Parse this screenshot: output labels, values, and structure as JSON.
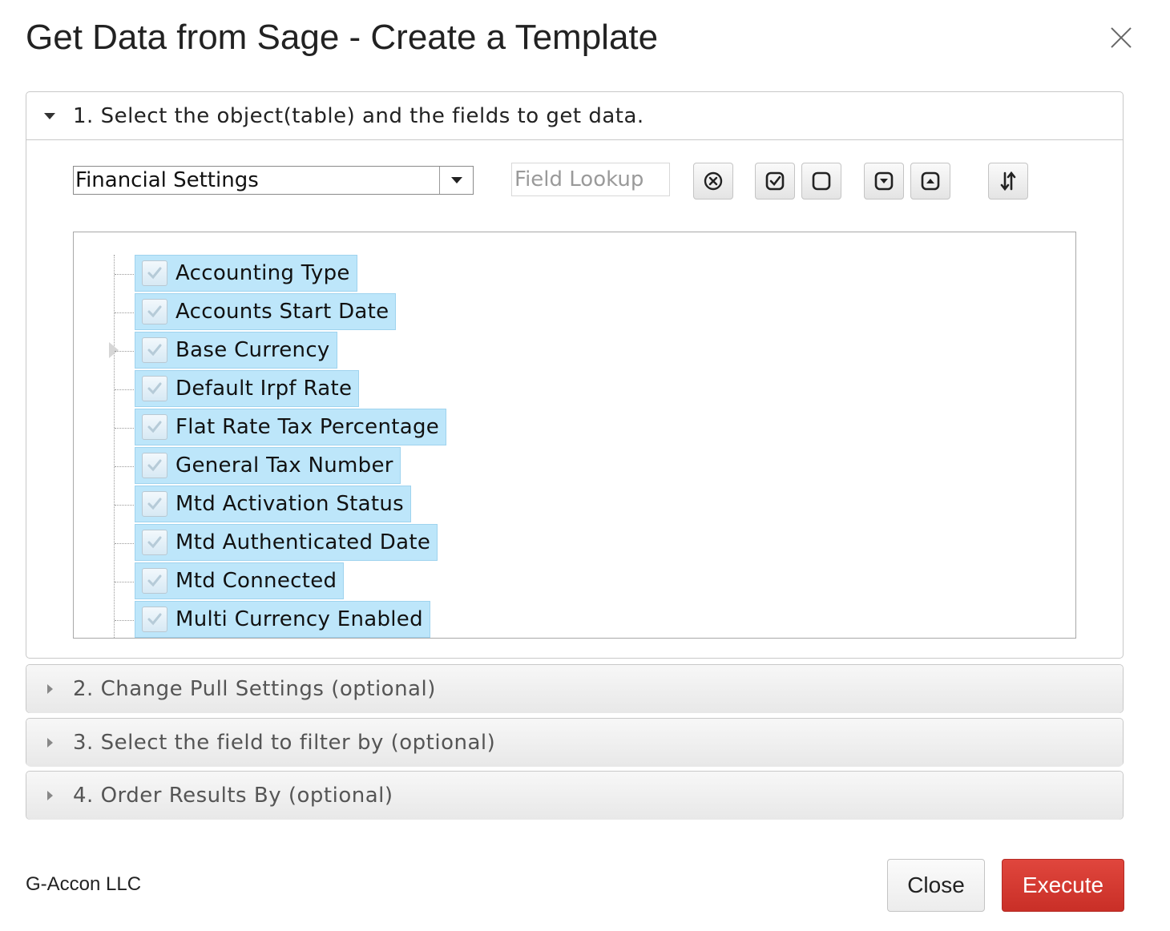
{
  "dialog": {
    "title": "Get Data from Sage - Create a Template",
    "close_icon": "close-icon"
  },
  "section1": {
    "title": "1. Select the object(table) and the fields to get data.",
    "object_select": {
      "value": "Financial Settings"
    },
    "field_lookup": {
      "placeholder": "Field Lookup",
      "value": ""
    },
    "toolbar": [
      {
        "name": "clear-lookup-button",
        "icon": "circle-x-icon"
      },
      {
        "name": "check-all-button",
        "icon": "checkbox-checked-icon"
      },
      {
        "name": "uncheck-all-button",
        "icon": "checkbox-empty-icon"
      },
      {
        "name": "expand-all-button",
        "icon": "caret-down-box-icon"
      },
      {
        "name": "collapse-all-button",
        "icon": "caret-up-box-icon"
      },
      {
        "name": "sort-button",
        "icon": "sort-arrows-icon"
      }
    ],
    "fields": [
      {
        "label": "Accounting Type",
        "checked": true
      },
      {
        "label": "Accounts Start Date",
        "checked": true
      },
      {
        "label": "Base Currency",
        "checked": true,
        "expandable": true
      },
      {
        "label": "Default Irpf Rate",
        "checked": true
      },
      {
        "label": "Flat Rate Tax Percentage",
        "checked": true
      },
      {
        "label": "General Tax Number",
        "checked": true
      },
      {
        "label": "Mtd Activation Status",
        "checked": true
      },
      {
        "label": "Mtd Authenticated Date",
        "checked": true
      },
      {
        "label": "Mtd Connected",
        "checked": true
      },
      {
        "label": "Multi Currency Enabled",
        "checked": true
      }
    ]
  },
  "section2": {
    "title": "2. Change Pull Settings (optional)"
  },
  "section3": {
    "title": "3. Select the field to filter by (optional)"
  },
  "section4": {
    "title": "4. Order Results By (optional)"
  },
  "footer": {
    "brand": "G-Accon LLC",
    "close_label": "Close",
    "execute_label": "Execute"
  },
  "colors": {
    "execute_button": "#d33a31",
    "selected_field_bg": "#bde6fa"
  }
}
